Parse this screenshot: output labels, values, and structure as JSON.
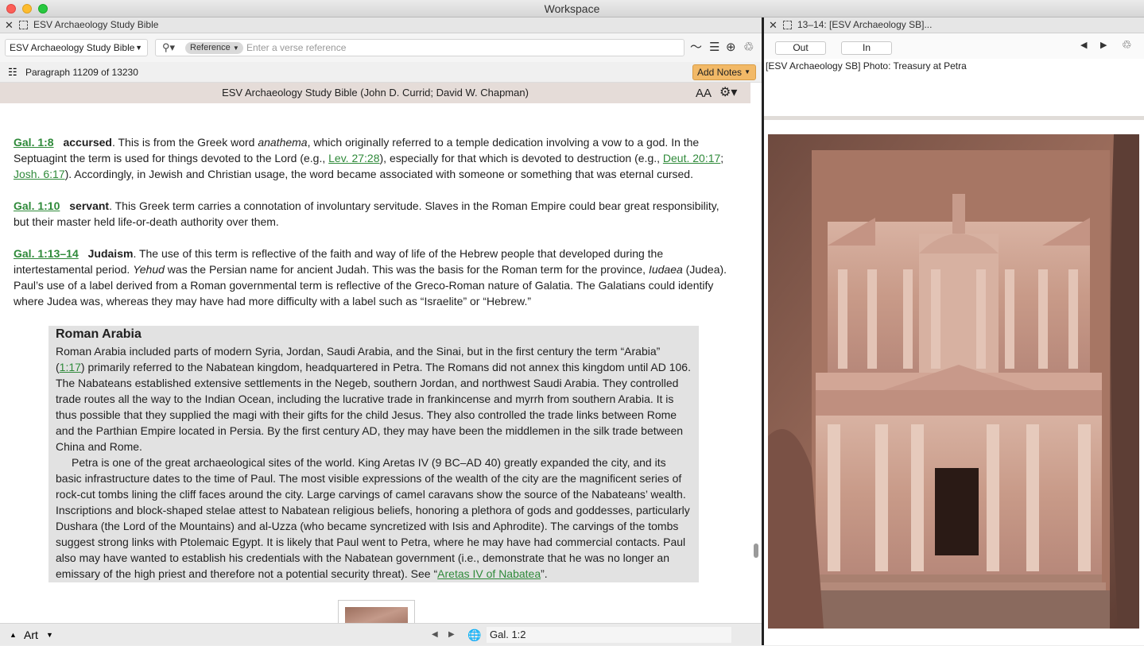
{
  "window": {
    "title": "Workspace"
  },
  "left_panel": {
    "tab_title": "ESV Archaeology Study Bible",
    "resource_select": "ESV Archaeology Study Bible",
    "search": {
      "mode": "Reference",
      "placeholder": "Enter a verse reference"
    },
    "paragraph_indicator": "Paragraph 11209 of 13230",
    "add_notes_label": "Add Notes",
    "resource_header": "ESV Archaeology Study Bible (John D. Currid; David W. Chapman)",
    "font_size_label": "AA",
    "notes": [
      {
        "ref": "Gal. 1:8",
        "term": "accursed",
        "parts": [
          ". This is from the Greek word ",
          "anathema",
          ", which originally referred to a temple dedication involving a vow to a god. In the Septuagint the term is used for things devoted to the Lord (e.g., ",
          "Lev. 27:28",
          "), especially for that which is devoted to destruction (e.g., ",
          "Deut. 20:17",
          "; ",
          "Josh. 6:17",
          "). Accordingly, in Jewish and Christian usage, the word became associated with someone or something that was eternal cursed."
        ]
      },
      {
        "ref": "Gal. 1:10",
        "term": "servant",
        "text": ". This Greek term carries a connotation of involuntary servitude. Slaves in the Roman Empire could bear great responsibility, but their master held life-or-death authority over them."
      },
      {
        "ref": "Gal. 1:13–14",
        "term": "Judaism",
        "parts": [
          ". The use of this term is reflective of the faith and way of life of the Hebrew people that developed during the intertestamental period. ",
          "Yehud",
          " was the Persian name for ancient Judah. This was the basis for the Roman term for the province, ",
          "Iudaea",
          " (Judea). Paul’s use of a label derived from a Roman governmental term is reflective of the Greco-Roman nature of Galatia. The Galatians could identify where Judea was, whereas they may have had more difficulty with a label such as “Israelite” or “Hebrew.”"
        ]
      }
    ],
    "sidebar_box": {
      "title": "Roman Arabia",
      "p1_before": "Roman Arabia included parts of modern Syria, Jordan, Saudi Arabia, and the Sinai, but in the first century the term “Arabia” (",
      "p1_link": "1:17",
      "p1_after": ") primarily referred to the Nabatean kingdom, headquartered in Petra. The Romans did not annex this kingdom until AD 106. The Nabateans established extensive settlements in the Negeb, southern Jordan, and northwest Saudi Arabia. They controlled trade routes all the way to the Indian Ocean, including the lucrative trade in frankincense and myrrh from southern Arabia. It is thus possible that they supplied the magi with their gifts for the child Jesus. They also controlled the trade links between Rome and the Parthian Empire located in Persia. By the first century AD, they may have been the middlemen in the silk trade between China and Rome.",
      "p2_before": "Petra is one of the great archaeological sites of the world. King Aretas IV (9 BC–AD 40) greatly expanded the city, and its basic infrastructure dates to the time of Paul. The most visible expressions of the wealth of the city are the magnificent series of rock-cut tombs lining the cliff faces around the city. Large carvings of camel caravans show the source of the Nabateans’ wealth. Inscriptions and block-shaped stelae attest to Nabatean religious beliefs, honoring a plethora of gods and goddesses, particularly Dushara (the Lord of the Mountains) and al-Uzza (who became syncretized with Isis and Aphrodite). The carvings of the tombs suggest strong links with Ptolemaic Egypt. It is likely that Paul went to Petra, where he may have had commercial contacts. Paul also may have wanted to establish his credentials with the Nabatean government (i.e., demonstrate that he was no longer an emissary of the high priest and therefore not a potential security threat). See “",
      "p2_link": "Aretas IV of Nabatea",
      "p2_after": "”."
    },
    "bottom": {
      "media_label": "Art",
      "verse": "Gal. 1:2"
    }
  },
  "right_panel": {
    "tab_title": "13–14: [ESV Archaeology SB]...",
    "zoom_out": "Out",
    "zoom_in": "In",
    "caption": "[ESV Archaeology SB] Photo: Treasury at Petra"
  },
  "colors": {
    "link": "#2f8a3a",
    "add_notes": "#f2b967",
    "header_bg": "#e5dcd8",
    "box_bg": "#e2e2e2"
  }
}
